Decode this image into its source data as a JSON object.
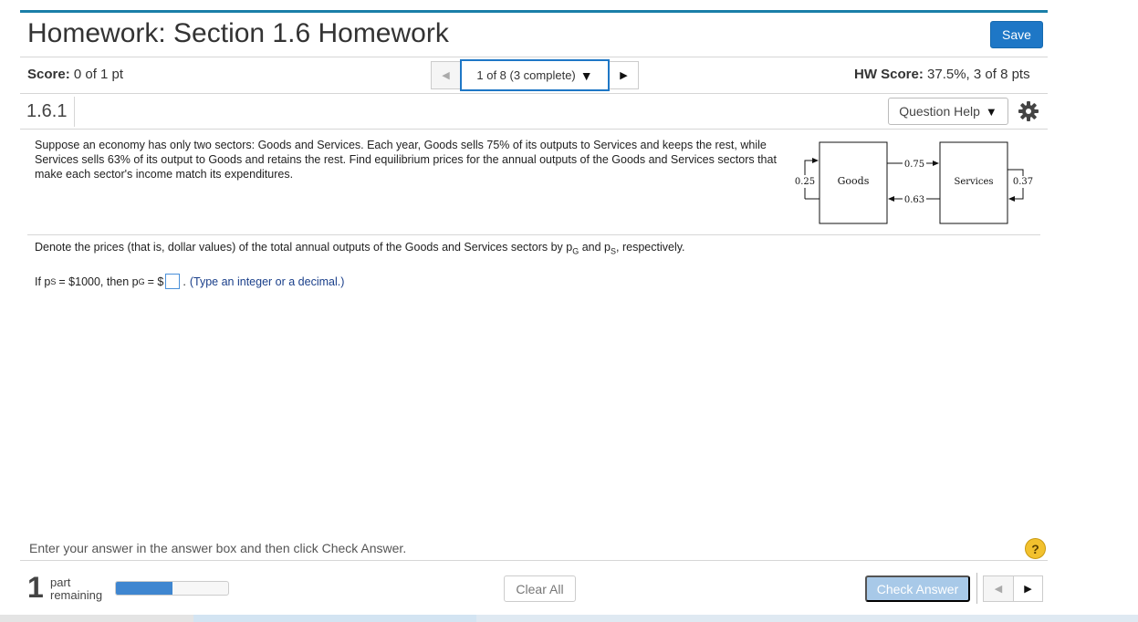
{
  "header": {
    "title": "Homework: Section 1.6 Homework",
    "save_label": "Save"
  },
  "status": {
    "score_label": "Score:",
    "score_value": "0 of 1 pt",
    "nav_label": "1 of 8 (3 complete)",
    "hw_score_label": "HW Score:",
    "hw_score_value": "37.5%, 3 of 8 pts"
  },
  "question": {
    "number": "1.6.1",
    "help_label": "Question Help",
    "text": "Suppose an economy has only two sectors: Goods and Services. Each year, Goods sells 75% of its outputs to Services and keeps the rest, while Services sells 63% of its output to Goods and retains the rest. Find equilibrium prices for the annual outputs of the Goods and Services sectors that make each sector's income match its expenditures.",
    "diagram": {
      "left_box": "Goods",
      "right_box": "Services",
      "goods_self": "0.25",
      "services_self": "0.37",
      "goods_to_services": "0.75",
      "services_to_goods": "0.63"
    },
    "denote_pre": "Denote the prices (that is, dollar values) of the total annual outputs of the Goods and Services sectors by p",
    "denote_sub_g": "G",
    "denote_mid": " and p",
    "denote_sub_s": "S",
    "denote_post": ", respectively.",
    "if_pre": "If p",
    "if_sub_s": "S",
    "if_mid": " = $1000, then p",
    "if_sub_g": "G",
    "if_eq": " = $",
    "if_post": ".",
    "hint": "(Type an integer or a decimal.)",
    "answer_value": ""
  },
  "footer": {
    "instruction": "Enter your answer in the answer box and then click Check Answer.",
    "parts_count": "1",
    "parts_label_1": "part",
    "parts_label_2": "remaining",
    "progress_fraction": 0.5,
    "clear_all_label": "Clear All",
    "check_answer_label": "Check Answer",
    "help_symbol": "?"
  },
  "colors": {
    "accent": "#1e77c6",
    "topbar": "#1a7fa8",
    "check_disabled": "#a8c9e8",
    "help_yellow": "#f2c12e"
  },
  "icons": {
    "settings": "gear-icon",
    "prev": "triangle-left-icon",
    "next": "triangle-right-icon",
    "dropdown": "caret-down-icon"
  }
}
